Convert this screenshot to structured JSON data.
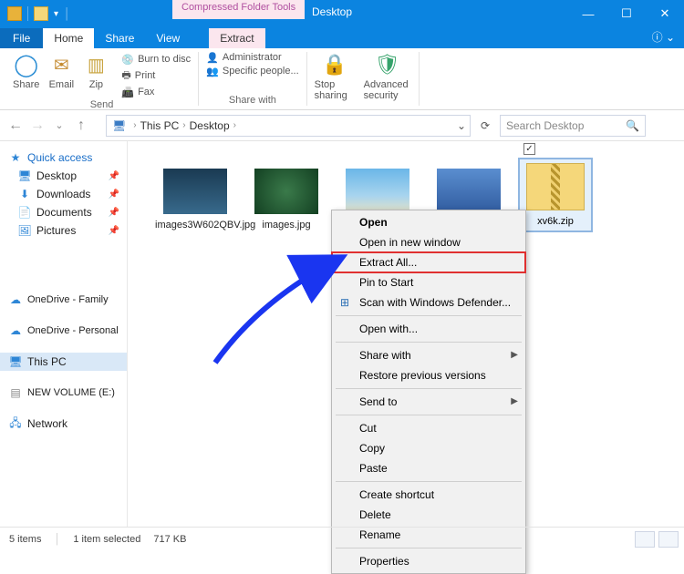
{
  "window": {
    "contextual_tab": "Compressed Folder Tools",
    "title": "Desktop"
  },
  "tabs": {
    "file": "File",
    "home": "Home",
    "share": "Share",
    "view": "View",
    "extract": "Extract"
  },
  "ribbon": {
    "share": "Share",
    "email": "Email",
    "zip": "Zip",
    "burn": "Burn to disc",
    "print": "Print",
    "fax": "Fax",
    "group_send": "Send",
    "admin": "Administrator",
    "specific": "Specific people...",
    "group_share": "Share with",
    "stop": "Stop sharing",
    "adv": "Advanced security"
  },
  "address": {
    "pc": "This PC",
    "loc": "Desktop"
  },
  "search": {
    "placeholder": "Search Desktop"
  },
  "nav": {
    "quick": "Quick access",
    "desktop": "Desktop",
    "downloads": "Downloads",
    "documents": "Documents",
    "pictures": "Pictures",
    "onedrive_family": "OneDrive - Family",
    "onedrive_personal": "OneDrive - Personal",
    "thispc": "This PC",
    "newvol": "NEW VOLUME (E:)",
    "network": "Network"
  },
  "files": [
    {
      "name": "images3W602QBV.jpg"
    },
    {
      "name": "images.jpg"
    },
    {
      "name": ""
    },
    {
      "name": ""
    },
    {
      "name": "xv6k.zip"
    }
  ],
  "context_menu": {
    "open": "Open",
    "open_new": "Open in new window",
    "extract_all": "Extract All...",
    "pin": "Pin to Start",
    "defender": "Scan with Windows Defender...",
    "open_with": "Open with...",
    "share_with": "Share with",
    "restore": "Restore previous versions",
    "send_to": "Send to",
    "cut": "Cut",
    "copy": "Copy",
    "paste": "Paste",
    "shortcut": "Create shortcut",
    "delete": "Delete",
    "rename": "Rename",
    "properties": "Properties"
  },
  "status": {
    "items": "5 items",
    "selected": "1 item selected",
    "size": "717 KB"
  }
}
